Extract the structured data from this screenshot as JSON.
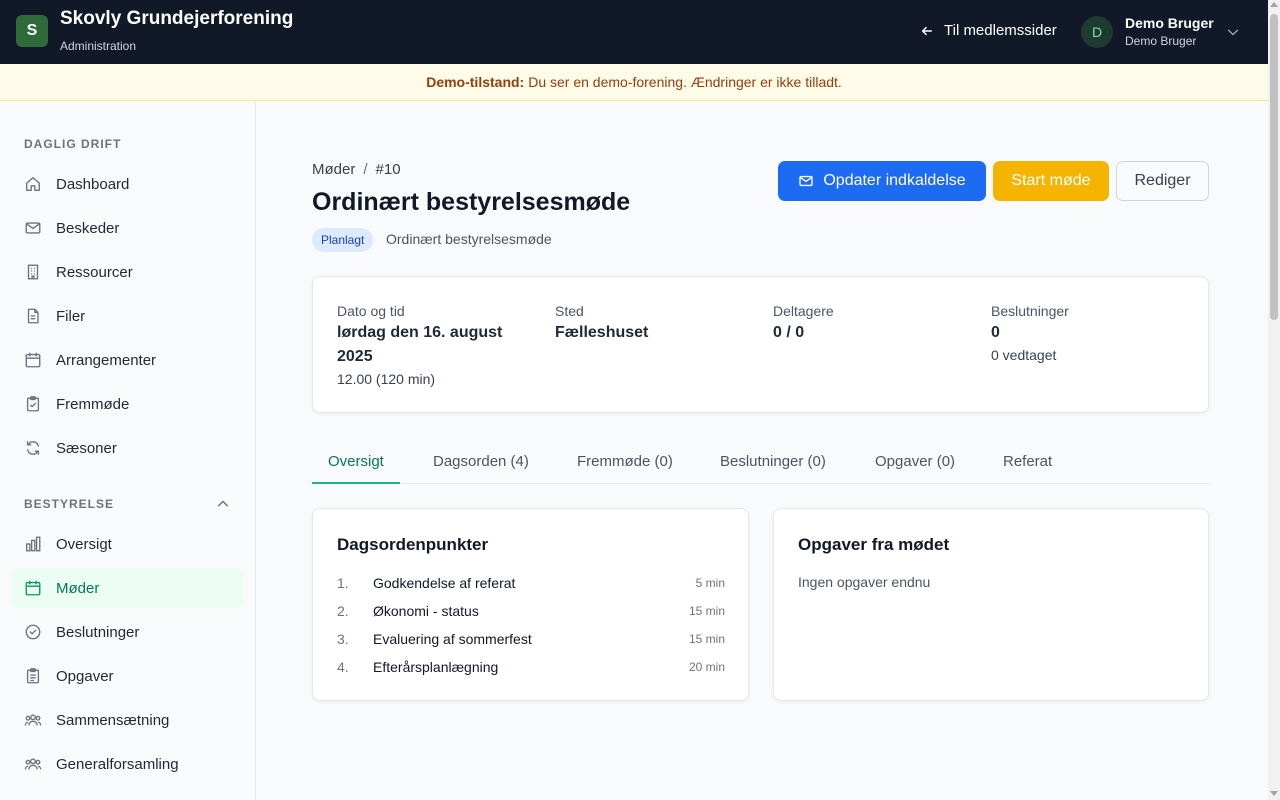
{
  "header": {
    "logo_letter": "S",
    "org_name": "Skovly Grundejerforening",
    "org_subtitle": "Administration",
    "back_link": "Til medlemssider",
    "user_initial": "D",
    "user_name": "Demo Bruger",
    "user_role": "Demo Bruger"
  },
  "banner": {
    "label": "Demo-tilstand:",
    "text": "Du ser en demo-forening. Ændringer er ikke tilladt."
  },
  "sidebar": {
    "section1_title": "DAGLIG DRIFT",
    "section1_items": [
      {
        "label": "Dashboard",
        "icon": "home-icon"
      },
      {
        "label": "Beskeder",
        "icon": "mail-icon"
      },
      {
        "label": "Ressourcer",
        "icon": "building-icon"
      },
      {
        "label": "Filer",
        "icon": "file-icon"
      },
      {
        "label": "Arrangementer",
        "icon": "calendar-icon"
      },
      {
        "label": "Fremmøde",
        "icon": "clipboard-check-icon"
      },
      {
        "label": "Sæsoner",
        "icon": "refresh-icon"
      }
    ],
    "section2_title": "BESTYRELSE",
    "section2_items": [
      {
        "label": "Oversigt",
        "icon": "bar-chart-icon"
      },
      {
        "label": "Møder",
        "icon": "calendar-icon",
        "active": true
      },
      {
        "label": "Beslutninger",
        "icon": "check-circle-icon"
      },
      {
        "label": "Opgaver",
        "icon": "clipboard-icon"
      },
      {
        "label": "Sammensætning",
        "icon": "users-icon"
      },
      {
        "label": "Generalforsamling",
        "icon": "users-icon"
      }
    ]
  },
  "main": {
    "breadcrumb": {
      "parent": "Møder",
      "separator": "/",
      "current": "#10"
    },
    "title": "Ordinært bestyrelsesmøde",
    "status_badge": "Planlagt",
    "meeting_type": "Ordinært bestyrelsesmøde",
    "buttons": {
      "update_invitation": "Opdater indkaldelse",
      "start_meeting": "Start møde",
      "edit": "Rediger"
    },
    "info": {
      "datetime_label": "Dato og tid",
      "datetime_value": "lørdag den 16. august 2025",
      "datetime_sub": "12.00 (120 min)",
      "place_label": "Sted",
      "place_value": "Fælleshuset",
      "participants_label": "Deltagere",
      "participants_value": "0 / 0",
      "decisions_label": "Beslutninger",
      "decisions_value": "0",
      "decisions_sub": "0 vedtaget"
    },
    "tabs": [
      "Oversigt",
      "Dagsorden (4)",
      "Fremmøde (0)",
      "Beslutninger (0)",
      "Opgaver (0)",
      "Referat"
    ],
    "active_tab": "Oversigt",
    "agenda": {
      "title": "Dagsordenpunkter",
      "items": [
        {
          "num": "1.",
          "title": "Godkendelse af referat",
          "duration": "5 min"
        },
        {
          "num": "2.",
          "title": "Økonomi - status",
          "duration": "15 min"
        },
        {
          "num": "3.",
          "title": "Evaluering af sommerfest",
          "duration": "15 min"
        },
        {
          "num": "4.",
          "title": "Efterårsplanlægning",
          "duration": "20 min"
        }
      ]
    },
    "tasks": {
      "title": "Opgaver fra mødet",
      "empty_text": "Ingen opgaver endnu"
    }
  },
  "colors": {
    "topbar": "#111827",
    "accent_green": "#047857",
    "primary_blue": "#1d6bf3",
    "warning_yellow": "#f4b400",
    "banner_bg": "#fefbe8"
  }
}
